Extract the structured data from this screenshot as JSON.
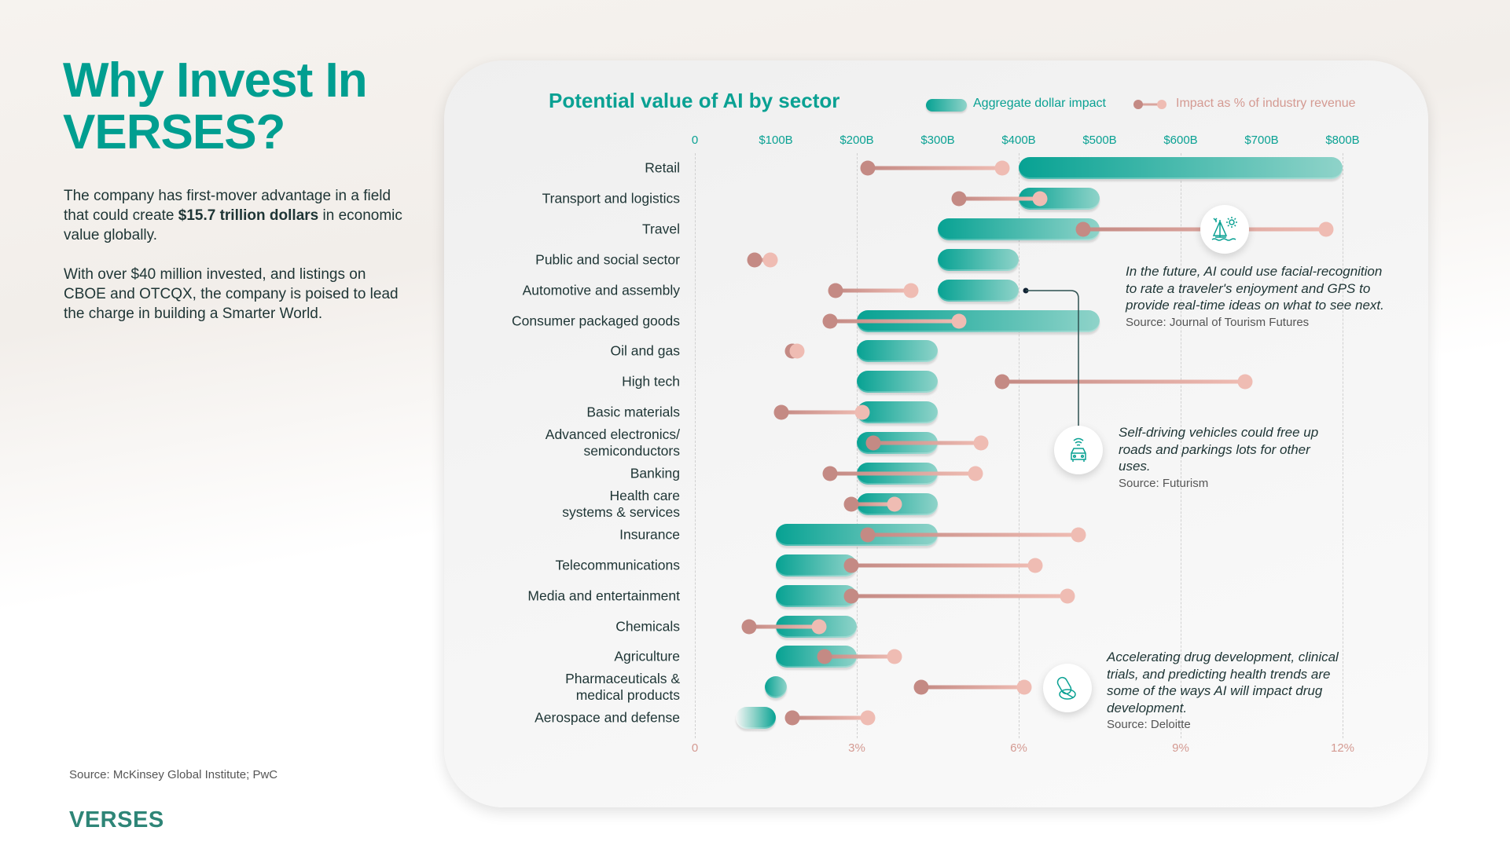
{
  "left": {
    "title_line1": "Why Invest In",
    "title_line2": "VERSES?",
    "para1_pre": "The company has first-mover advantage in a field that could create ",
    "para1_bold": "$15.7 trillion dollars",
    "para1_post": " in economic value globally.",
    "para2": "With over $40 million invested, and listings on CBOE and OTCQX, the company is poised to lead the charge in building a Smarter World.",
    "source": "Source: McKinsey Global Institute; PwC",
    "logo": "VERSES"
  },
  "chart_data": {
    "type": "bar",
    "title": "Potential value of AI by sector",
    "legend": {
      "placement": "top-right",
      "bar_label": "Aggregate dollar impact",
      "dot_label": "Impact as % of industry revenue"
    },
    "colors": {
      "bar_start": "#07a293",
      "bar_end": "#8fd3c9",
      "dot_low": "#c48a84",
      "dot_high": "#efbcb3",
      "title": "#0aa193"
    },
    "top_axis": {
      "ticks": [
        "0",
        "$100B",
        "$200B",
        "$300B",
        "$400B",
        "$500B",
        "$600B",
        "$700B",
        "$800B"
      ],
      "range": [
        0,
        800
      ],
      "unit": "$B"
    },
    "bottom_axis": {
      "ticks": [
        "0",
        "3%",
        "6%",
        "9%",
        "12%"
      ],
      "range": [
        0,
        12
      ],
      "unit": "%"
    },
    "grid": true,
    "categories": [
      "Retail",
      "Transport and logistics",
      "Travel",
      "Public and social sector",
      "Automotive and assembly",
      "Consumer packaged goods",
      "Oil and gas",
      "High tech",
      "Basic materials",
      "Advanced electronics/\nsemiconductors",
      "Banking",
      "Health care\nsystems & services",
      "Insurance",
      "Telecommunications",
      "Media and entertainment",
      "Chemicals",
      "Agriculture",
      "Pharmaceuticals &\nmedical products",
      "Aerospace and defense"
    ],
    "dollar_range": [
      [
        400,
        800
      ],
      [
        400,
        500
      ],
      [
        300,
        500
      ],
      [
        300,
        400
      ],
      [
        300,
        400
      ],
      [
        200,
        500
      ],
      [
        200,
        300
      ],
      [
        200,
        300
      ],
      [
        200,
        300
      ],
      [
        200,
        300
      ],
      [
        200,
        300
      ],
      [
        200,
        300
      ],
      [
        100,
        300
      ],
      [
        100,
        200
      ],
      [
        100,
        200
      ],
      [
        100,
        200
      ],
      [
        100,
        200
      ],
      [
        100,
        100
      ],
      [
        50,
        100
      ]
    ],
    "percent_range": [
      [
        3.2,
        5.7
      ],
      [
        4.9,
        6.4
      ],
      [
        7.2,
        11.7
      ],
      [
        1.1,
        1.4
      ],
      [
        2.6,
        4.0
      ],
      [
        2.5,
        4.9
      ],
      [
        1.8,
        1.9
      ],
      [
        5.7,
        10.2
      ],
      [
        1.6,
        3.1
      ],
      [
        3.3,
        5.3
      ],
      [
        2.5,
        5.2
      ],
      [
        2.9,
        3.7
      ],
      [
        3.2,
        7.1
      ],
      [
        2.9,
        6.3
      ],
      [
        2.9,
        6.9
      ],
      [
        1.0,
        2.3
      ],
      [
        2.4,
        3.7
      ],
      [
        4.2,
        6.1
      ],
      [
        1.8,
        3.2
      ]
    ]
  },
  "annotations": [
    {
      "icon": "sailboat-sun-icon",
      "text": "In the future, AI could use facial-recognition to rate a traveler's enjoyment and GPS to provide real-time ideas on what to see next.",
      "source": "Source: Journal of Tourism Futures"
    },
    {
      "icon": "self-driving-car-icon",
      "text": "Self-driving vehicles could free up roads and parkings lots for other uses.",
      "source": "Source: Futurism"
    },
    {
      "icon": "pill-icon",
      "text": "Accelerating drug development, clinical trials, and predicting health trends are some of the ways AI will impact drug development.",
      "source": "Source: Deloitte"
    }
  ]
}
